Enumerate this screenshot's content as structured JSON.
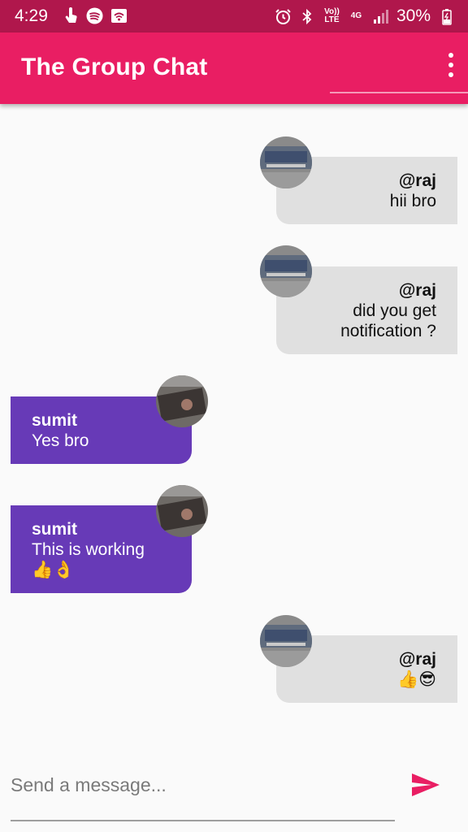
{
  "status_bar": {
    "time": "4:29",
    "battery": "30%",
    "left_icons": [
      "touch-icon",
      "spotify-icon",
      "wifi-cast-icon"
    ],
    "right_icons": [
      "alarm-icon",
      "bluetooth-icon",
      "volte-icon",
      "4g-icon",
      "signal-icon",
      "battery-charging-icon"
    ],
    "volte_label": "Vo)) LTE",
    "network_label": "4G"
  },
  "app_bar": {
    "title": "The Group Chat",
    "menu_icon": "more-vert-icon"
  },
  "colors": {
    "status_bar": "#b0174c",
    "app_bar": "#e91e63",
    "sent_bubble": "#e0e0e0",
    "received_bubble": "#673ab7",
    "send_icon": "#e91e63",
    "background": "#fafafa"
  },
  "messages": [
    {
      "type": "sent",
      "sender": "@raj",
      "text": "hii bro"
    },
    {
      "type": "sent",
      "sender": "@raj",
      "text": "did you get\nnotification ?"
    },
    {
      "type": "received",
      "sender": "sumit",
      "text": "Yes bro"
    },
    {
      "type": "received",
      "sender": "sumit",
      "text": "This is working\n👍👌"
    },
    {
      "type": "sent",
      "sender": "@raj",
      "text": "👍😎"
    }
  ],
  "composer": {
    "placeholder": "Send a message...",
    "value": "",
    "send_icon": "send-icon"
  }
}
